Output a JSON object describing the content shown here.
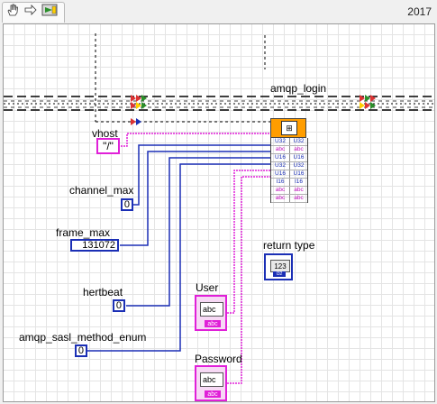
{
  "toolbar": {
    "icons": [
      "hand-icon",
      "arrow-right-icon",
      "run-arrow-icon"
    ],
    "version": "2017"
  },
  "diagram": {
    "subvi_name": "amqp_login",
    "subvi_terminals": [
      {
        "left": "U32",
        "right": "U32"
      },
      {
        "left": "abc",
        "right": "abc"
      },
      {
        "left": "U16",
        "right": "U16"
      },
      {
        "left": "U32",
        "right": "U32"
      },
      {
        "left": "U16",
        "right": "U16"
      },
      {
        "left": "I16",
        "right": "I16"
      },
      {
        "left": "abc",
        "right": "abc"
      },
      {
        "left": "abc",
        "right": "abc"
      }
    ],
    "vhost": {
      "label": "vhost",
      "value": "\"/\""
    },
    "channel_max": {
      "label": "channel_max",
      "value": "0"
    },
    "frame_max": {
      "label": "frame_max",
      "value": "131072"
    },
    "heartbeat": {
      "label": "hertbeat",
      "value": "0"
    },
    "sasl_method": {
      "label": "amqp_sasl_method_enum",
      "value": "0"
    },
    "user": {
      "label": "User",
      "inner": "abc",
      "tail": "abc"
    },
    "password": {
      "label": "Password",
      "inner": "abc",
      "tail": "abc"
    },
    "return_type": {
      "label": "return type",
      "inner": "123",
      "tail": "I32"
    },
    "colors": {
      "string_wire": "#e020d8",
      "numeric_wire": "#1b2fb5",
      "subvi": "#ff9d00",
      "error_cluster": "#000000"
    }
  }
}
